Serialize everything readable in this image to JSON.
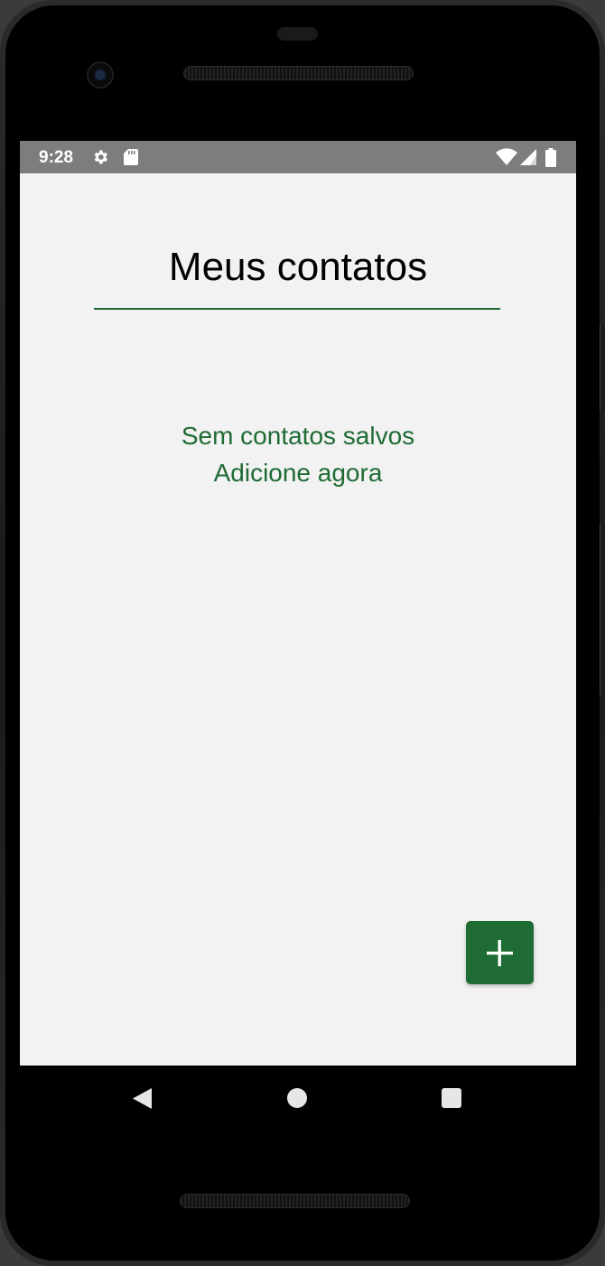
{
  "status_bar": {
    "time": "9:28",
    "left_icons": [
      "gear-icon",
      "sd-card-icon"
    ],
    "right_icons": [
      "wifi-icon",
      "signal-icon",
      "battery-icon"
    ]
  },
  "app": {
    "title": "Meus contatos",
    "empty_state": {
      "line1": "Sem contatos salvos",
      "line2": "Adicione agora"
    },
    "fab_icon": "plus-icon"
  },
  "navigation": {
    "back_icon": "back-triangle-icon",
    "home_icon": "home-circle-icon",
    "recents_icon": "recents-square-icon"
  },
  "colors": {
    "accent": "#1e6b34",
    "screen_background": "#f2f2f2",
    "status_bar": "#7d7d7d",
    "device_body": "#000000"
  }
}
